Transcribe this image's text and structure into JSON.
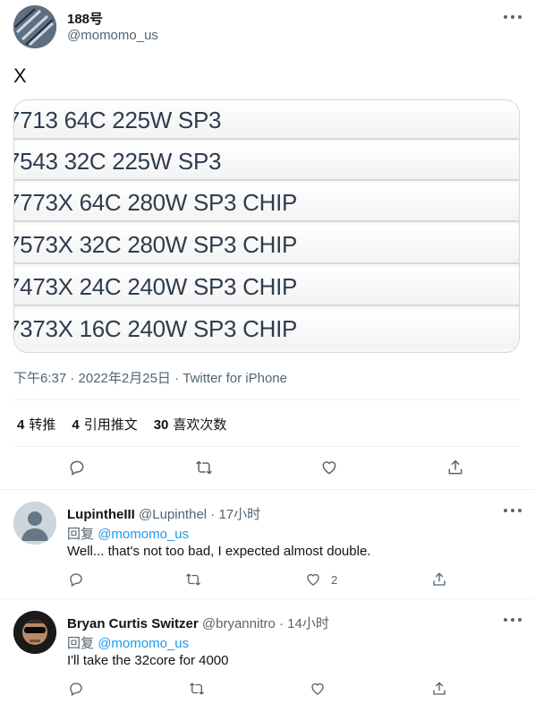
{
  "tweet": {
    "author_name": "188号",
    "author_handle": "@momomo_us",
    "text": "X",
    "media_rows": [
      "7713 64C 225W SP3",
      "7543 32C 225W SP3",
      "7773X 64C 280W SP3 CHIP",
      "7573X 32C 280W SP3 CHIP",
      "7473X 24C 240W SP3 CHIP",
      "7373X 16C 240W SP3 CHIP"
    ],
    "timestamp": "下午6:37 · 2022年2月25日 · Twitter for iPhone",
    "stats": {
      "retweets_count": "4",
      "retweets_label": "转推",
      "quotes_count": "4",
      "quotes_label": "引用推文",
      "likes_count": "30",
      "likes_label": "喜欢次数"
    }
  },
  "replies": [
    {
      "name": "LupintheIII",
      "handle": "@Lupinthel · 17小时",
      "reply_prefix": "回复",
      "reply_to": "@momomo_us",
      "text": "Well... that's not too bad, I expected almost double.",
      "like_count": "2"
    },
    {
      "name": "Bryan Curtis Switzer",
      "handle": "@bryannitro · 14小时",
      "reply_prefix": "回复",
      "reply_to": "@momomo_us",
      "text": "I'll take the 32core for 4000",
      "like_count": ""
    }
  ],
  "colors": {
    "link": "#1d9bf0",
    "secondary": "#536471",
    "icon": "#536471"
  }
}
